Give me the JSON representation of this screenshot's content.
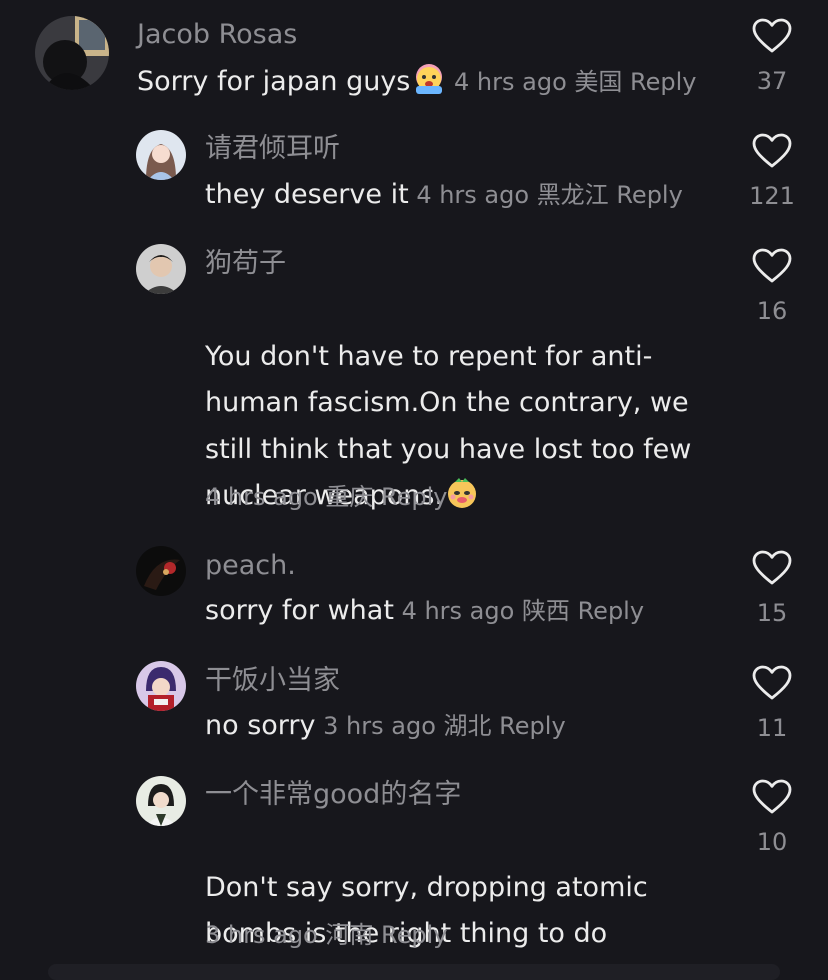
{
  "comments": [
    {
      "username": "Jacob Rosas",
      "text": "Sorry for japan guys",
      "emoji": "crying-face-emoji",
      "time": "4 hrs ago",
      "location": "美国",
      "reply_label": "Reply",
      "likes": "37"
    },
    {
      "username": "请君倾耳听",
      "text": "they deserve it",
      "time": "4 hrs ago",
      "location": "黑龙江",
      "reply_label": "Reply",
      "likes": "121"
    },
    {
      "username": "狗苟子",
      "text": "You don't have to repent for anti-\nhuman fascism.On the contrary, we\nstill think that you have lost too few\nnuclear weapons.",
      "emoji": "smirk-dog-emoji",
      "time": "4 hrs ago",
      "location": "重庆",
      "reply_label": "Reply",
      "likes": "16"
    },
    {
      "username": "peach.",
      "text": "sorry for what",
      "time": "4 hrs ago",
      "location": "陕西",
      "reply_label": "Reply",
      "likes": "15"
    },
    {
      "username": "干饭小当家",
      "text": "no sorry",
      "time": "3 hrs ago",
      "location": "湖北",
      "reply_label": "Reply",
      "likes": "11"
    },
    {
      "username": "一个非常good的名字",
      "text": "Don't say sorry, dropping atomic\nbombs is the right thing to do",
      "time": "3 hrs ago",
      "location": "河南",
      "reply_label": "Reply",
      "likes": "10"
    }
  ],
  "icons": {
    "like": "heart-outline-icon"
  },
  "colors": {
    "background": "#17171c",
    "text": "#ececec",
    "muted": "#8e8e93"
  }
}
